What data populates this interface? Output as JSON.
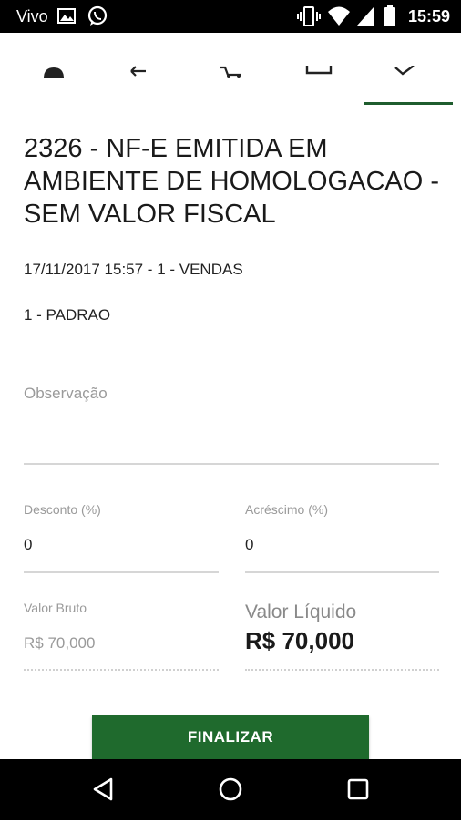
{
  "status_bar": {
    "carrier": "Vivo",
    "time": "15:59",
    "icons": [
      "image-icon",
      "whatsapp-icon",
      "vibrate-icon",
      "wifi-icon",
      "signal-icon",
      "battery-icon"
    ]
  },
  "tabs": {
    "icons": [
      "user-icon",
      "back-arrow-icon",
      "cart-icon",
      "folder-icon",
      "check-icon"
    ],
    "active_index": 4
  },
  "document": {
    "title": "2326 - NF-E EMITIDA EM AMBIENTE DE HOMOLOGACAO - SEM VALOR FISCAL",
    "datetime_line": "17/11/2017 15:57 - 1 - VENDAS",
    "price_table": "1 - PADRAO"
  },
  "form": {
    "observacao_label": "Observação",
    "observacao_value": "",
    "desconto_label": "Desconto (%)",
    "desconto_value": "0",
    "acrescimo_label": "Acréscimo (%)",
    "acrescimo_value": "0",
    "valor_bruto_label": "Valor Bruto",
    "valor_bruto_value": "R$ 70,000",
    "valor_liquido_label": "Valor Líquido",
    "valor_liquido_value": "R$ 70,000"
  },
  "actions": {
    "finalizar_label": "FINALIZAR"
  },
  "nav_bar": {
    "icons": [
      "back-triangle-icon",
      "home-circle-icon",
      "recents-square-icon"
    ]
  },
  "colors": {
    "primary_green": "#1f6a2d",
    "tab_indicator": "#1f5d2e"
  }
}
